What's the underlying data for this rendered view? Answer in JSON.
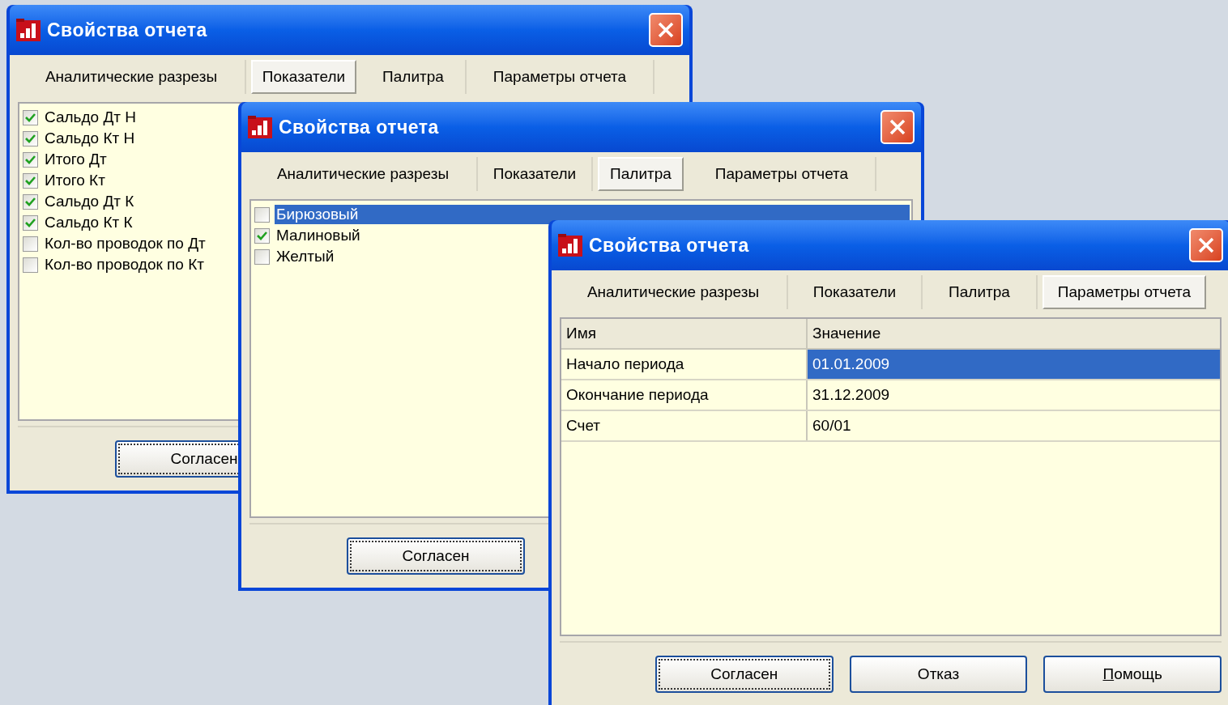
{
  "windows": [
    {
      "title": "Свойства отчета",
      "tabs": [
        {
          "label": "Аналитические разрезы",
          "selected": false
        },
        {
          "label": "Показатели",
          "selected": true
        },
        {
          "label": "Палитра",
          "selected": false
        },
        {
          "label": "Параметры отчета",
          "selected": false
        }
      ],
      "content": {
        "kind": "checklist",
        "items": [
          {
            "label": "Сальдо Дт Н",
            "checked": true,
            "selected": false
          },
          {
            "label": "Сальдо Кт Н",
            "checked": true,
            "selected": false
          },
          {
            "label": "Итого Дт",
            "checked": true,
            "selected": false
          },
          {
            "label": "Итого Кт",
            "checked": true,
            "selected": false
          },
          {
            "label": "Сальдо Дт К",
            "checked": true,
            "selected": false
          },
          {
            "label": "Сальдо Кт К",
            "checked": true,
            "selected": false
          },
          {
            "label": "Кол-во проводок по Дт",
            "checked": false,
            "selected": false
          },
          {
            "label": "Кол-во проводок по Кт",
            "checked": false,
            "selected": false
          }
        ]
      },
      "buttons": [
        {
          "label": "Согласен",
          "focused": true,
          "underline_first": false
        }
      ]
    },
    {
      "title": "Свойства отчета",
      "tabs": [
        {
          "label": "Аналитические разрезы",
          "selected": false
        },
        {
          "label": "Показатели",
          "selected": false
        },
        {
          "label": "Палитра",
          "selected": true
        },
        {
          "label": "Параметры отчета",
          "selected": false
        }
      ],
      "content": {
        "kind": "checklist",
        "items": [
          {
            "label": "Бирюзовый",
            "checked": false,
            "selected": true
          },
          {
            "label": "Малиновый",
            "checked": true,
            "selected": false
          },
          {
            "label": "Желтый",
            "checked": false,
            "selected": false
          }
        ]
      },
      "buttons": [
        {
          "label": "Согласен",
          "focused": true,
          "underline_first": false
        }
      ]
    },
    {
      "title": "Свойства отчета",
      "tabs": [
        {
          "label": "Аналитические разрезы",
          "selected": false
        },
        {
          "label": "Показатели",
          "selected": false
        },
        {
          "label": "Палитра",
          "selected": false
        },
        {
          "label": "Параметры отчета",
          "selected": true
        }
      ],
      "content": {
        "kind": "table",
        "columns": [
          "Имя",
          "Значение"
        ],
        "rows": [
          {
            "cells": [
              "Начало периода",
              "01.01.2009"
            ],
            "selected": true
          },
          {
            "cells": [
              "Окончание периода",
              "31.12.2009"
            ],
            "selected": false
          },
          {
            "cells": [
              "Счет",
              "60/01"
            ],
            "selected": false
          }
        ]
      },
      "buttons": [
        {
          "label": "Согласен",
          "focused": true,
          "underline_first": false
        },
        {
          "label": "Отказ",
          "focused": false,
          "underline_first": false
        },
        {
          "label": "Помощь",
          "focused": false,
          "underline_first": true
        }
      ]
    }
  ]
}
